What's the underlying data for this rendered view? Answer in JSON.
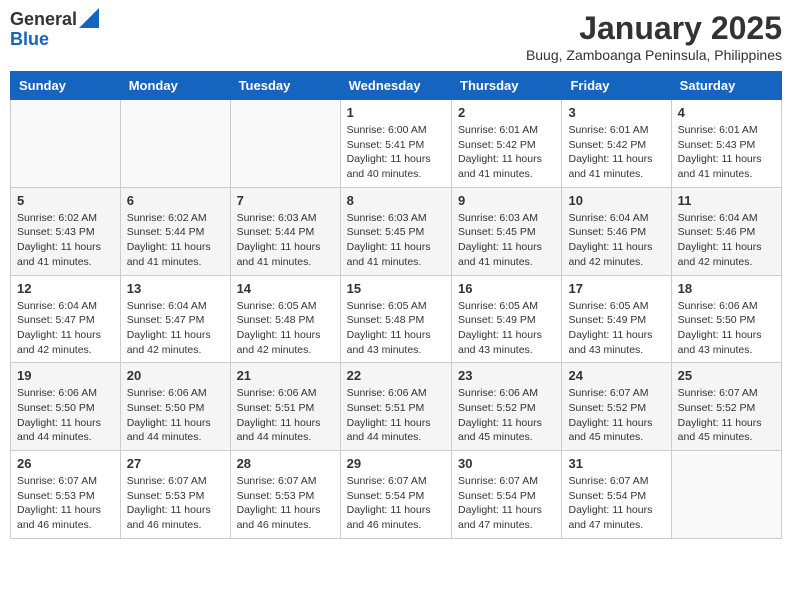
{
  "logo": {
    "general": "General",
    "blue": "Blue"
  },
  "title": "January 2025",
  "location": "Buug, Zamboanga Peninsula, Philippines",
  "days_of_week": [
    "Sunday",
    "Monday",
    "Tuesday",
    "Wednesday",
    "Thursday",
    "Friday",
    "Saturday"
  ],
  "weeks": [
    [
      {
        "day": "",
        "info": ""
      },
      {
        "day": "",
        "info": ""
      },
      {
        "day": "",
        "info": ""
      },
      {
        "day": "1",
        "info": "Sunrise: 6:00 AM\nSunset: 5:41 PM\nDaylight: 11 hours and 40 minutes."
      },
      {
        "day": "2",
        "info": "Sunrise: 6:01 AM\nSunset: 5:42 PM\nDaylight: 11 hours and 41 minutes."
      },
      {
        "day": "3",
        "info": "Sunrise: 6:01 AM\nSunset: 5:42 PM\nDaylight: 11 hours and 41 minutes."
      },
      {
        "day": "4",
        "info": "Sunrise: 6:01 AM\nSunset: 5:43 PM\nDaylight: 11 hours and 41 minutes."
      }
    ],
    [
      {
        "day": "5",
        "info": "Sunrise: 6:02 AM\nSunset: 5:43 PM\nDaylight: 11 hours and 41 minutes."
      },
      {
        "day": "6",
        "info": "Sunrise: 6:02 AM\nSunset: 5:44 PM\nDaylight: 11 hours and 41 minutes."
      },
      {
        "day": "7",
        "info": "Sunrise: 6:03 AM\nSunset: 5:44 PM\nDaylight: 11 hours and 41 minutes."
      },
      {
        "day": "8",
        "info": "Sunrise: 6:03 AM\nSunset: 5:45 PM\nDaylight: 11 hours and 41 minutes."
      },
      {
        "day": "9",
        "info": "Sunrise: 6:03 AM\nSunset: 5:45 PM\nDaylight: 11 hours and 41 minutes."
      },
      {
        "day": "10",
        "info": "Sunrise: 6:04 AM\nSunset: 5:46 PM\nDaylight: 11 hours and 42 minutes."
      },
      {
        "day": "11",
        "info": "Sunrise: 6:04 AM\nSunset: 5:46 PM\nDaylight: 11 hours and 42 minutes."
      }
    ],
    [
      {
        "day": "12",
        "info": "Sunrise: 6:04 AM\nSunset: 5:47 PM\nDaylight: 11 hours and 42 minutes."
      },
      {
        "day": "13",
        "info": "Sunrise: 6:04 AM\nSunset: 5:47 PM\nDaylight: 11 hours and 42 minutes."
      },
      {
        "day": "14",
        "info": "Sunrise: 6:05 AM\nSunset: 5:48 PM\nDaylight: 11 hours and 42 minutes."
      },
      {
        "day": "15",
        "info": "Sunrise: 6:05 AM\nSunset: 5:48 PM\nDaylight: 11 hours and 43 minutes."
      },
      {
        "day": "16",
        "info": "Sunrise: 6:05 AM\nSunset: 5:49 PM\nDaylight: 11 hours and 43 minutes."
      },
      {
        "day": "17",
        "info": "Sunrise: 6:05 AM\nSunset: 5:49 PM\nDaylight: 11 hours and 43 minutes."
      },
      {
        "day": "18",
        "info": "Sunrise: 6:06 AM\nSunset: 5:50 PM\nDaylight: 11 hours and 43 minutes."
      }
    ],
    [
      {
        "day": "19",
        "info": "Sunrise: 6:06 AM\nSunset: 5:50 PM\nDaylight: 11 hours and 44 minutes."
      },
      {
        "day": "20",
        "info": "Sunrise: 6:06 AM\nSunset: 5:50 PM\nDaylight: 11 hours and 44 minutes."
      },
      {
        "day": "21",
        "info": "Sunrise: 6:06 AM\nSunset: 5:51 PM\nDaylight: 11 hours and 44 minutes."
      },
      {
        "day": "22",
        "info": "Sunrise: 6:06 AM\nSunset: 5:51 PM\nDaylight: 11 hours and 44 minutes."
      },
      {
        "day": "23",
        "info": "Sunrise: 6:06 AM\nSunset: 5:52 PM\nDaylight: 11 hours and 45 minutes."
      },
      {
        "day": "24",
        "info": "Sunrise: 6:07 AM\nSunset: 5:52 PM\nDaylight: 11 hours and 45 minutes."
      },
      {
        "day": "25",
        "info": "Sunrise: 6:07 AM\nSunset: 5:52 PM\nDaylight: 11 hours and 45 minutes."
      }
    ],
    [
      {
        "day": "26",
        "info": "Sunrise: 6:07 AM\nSunset: 5:53 PM\nDaylight: 11 hours and 46 minutes."
      },
      {
        "day": "27",
        "info": "Sunrise: 6:07 AM\nSunset: 5:53 PM\nDaylight: 11 hours and 46 minutes."
      },
      {
        "day": "28",
        "info": "Sunrise: 6:07 AM\nSunset: 5:53 PM\nDaylight: 11 hours and 46 minutes."
      },
      {
        "day": "29",
        "info": "Sunrise: 6:07 AM\nSunset: 5:54 PM\nDaylight: 11 hours and 46 minutes."
      },
      {
        "day": "30",
        "info": "Sunrise: 6:07 AM\nSunset: 5:54 PM\nDaylight: 11 hours and 47 minutes."
      },
      {
        "day": "31",
        "info": "Sunrise: 6:07 AM\nSunset: 5:54 PM\nDaylight: 11 hours and 47 minutes."
      },
      {
        "day": "",
        "info": ""
      }
    ]
  ]
}
